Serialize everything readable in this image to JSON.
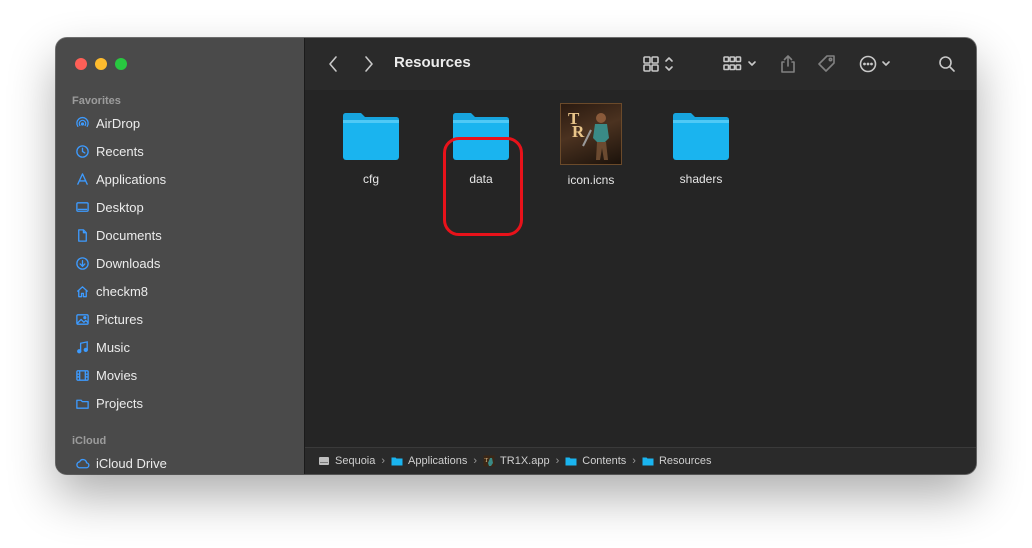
{
  "window": {
    "title": "Resources"
  },
  "sidebar": {
    "favorites_header": "Favorites",
    "icloud_header": "iCloud",
    "items": [
      {
        "label": "AirDrop",
        "icon": "airdrop-icon"
      },
      {
        "label": "Recents",
        "icon": "clock-icon"
      },
      {
        "label": "Applications",
        "icon": "applications-icon"
      },
      {
        "label": "Desktop",
        "icon": "desktop-icon"
      },
      {
        "label": "Documents",
        "icon": "document-icon"
      },
      {
        "label": "Downloads",
        "icon": "download-icon"
      },
      {
        "label": "checkm8",
        "icon": "home-icon"
      },
      {
        "label": "Pictures",
        "icon": "pictures-icon"
      },
      {
        "label": "Music",
        "icon": "music-icon"
      },
      {
        "label": "Movies",
        "icon": "movies-icon"
      },
      {
        "label": "Projects",
        "icon": "folder-icon"
      }
    ],
    "icloud_items": [
      {
        "label": "iCloud Drive",
        "icon": "cloud-icon"
      }
    ]
  },
  "toolbar": {
    "back": "chevron-left-icon",
    "forward": "chevron-right-icon",
    "view": "grid-view-icon",
    "group": "group-icon",
    "share": "share-icon",
    "tag": "tag-icon",
    "more": "more-icon",
    "search": "search-icon"
  },
  "files": [
    {
      "name": "cfg",
      "kind": "folder"
    },
    {
      "name": "data",
      "kind": "folder",
      "highlighted": true
    },
    {
      "name": "icon.icns",
      "kind": "icns"
    },
    {
      "name": "shaders",
      "kind": "folder"
    }
  ],
  "pathbar": {
    "crumbs": [
      "Sequoia",
      "Applications",
      "TR1X.app",
      "Contents",
      "Resources"
    ]
  },
  "colors": {
    "accent": "#0a84ff",
    "folder": "#1ab4ef",
    "highlight": "#e8121a",
    "sidebar_bg": "#4a4a4a",
    "content_bg": "#252525"
  }
}
